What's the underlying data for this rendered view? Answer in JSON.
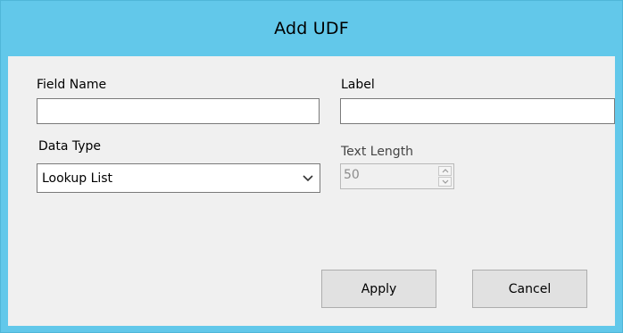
{
  "window": {
    "title": "Add UDF"
  },
  "form": {
    "field_name_label": "Field Name",
    "field_name_value": "",
    "label_label": "Label",
    "label_value": "",
    "data_type_label": "Data Type",
    "data_type_selected": "Lookup List",
    "text_length_label": "Text Length",
    "text_length_value": "50",
    "text_length_enabled": false
  },
  "buttons": {
    "apply_label": "Apply",
    "cancel_label": "Cancel"
  },
  "colors": {
    "title_bar": "#62c8ea",
    "client_background": "#f0f0f0",
    "button_face": "#e1e1e1"
  }
}
